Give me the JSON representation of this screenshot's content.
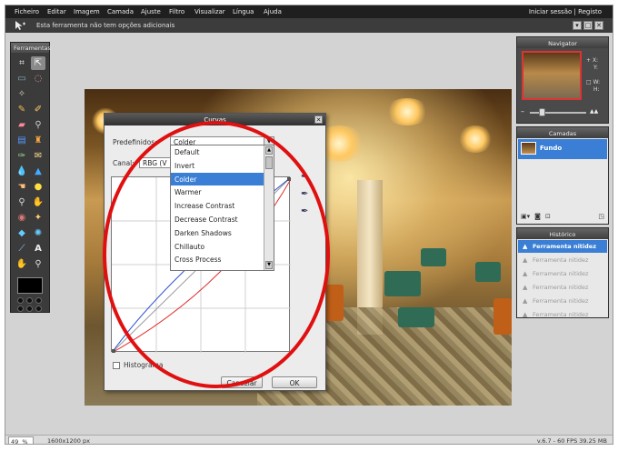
{
  "menubar": {
    "items": [
      "Ficheiro",
      "Editar",
      "Imagem",
      "Camada",
      "Ajuste",
      "Filtro",
      "Visualizar",
      "Língua",
      "Ajuda"
    ],
    "right_text": "Iniciar sessão  |  Registo"
  },
  "optionsbar": {
    "message": "Esta ferramenta não tem opções adicionais"
  },
  "tools_panel": {
    "title": "Ferramentas"
  },
  "curves_dialog": {
    "title": "Curvas",
    "preset_label": "Predefinidos:",
    "preset_value": "Colder",
    "channel_label": "Canal:",
    "channel_value": "RBG (V",
    "histogram_label": "Histograma",
    "cancel_label": "Cancelar",
    "ok_label": "OK"
  },
  "preset_dropdown": {
    "options": [
      "Default",
      "Invert",
      "Colder",
      "Warmer",
      "Increase Contrast",
      "Decrease Contrast",
      "Darken Shadows",
      "Chillauto",
      "Cross Process"
    ],
    "selected": "Colder"
  },
  "navigator": {
    "title": "Navigator",
    "x_label": "X:",
    "y_label": "Y:",
    "w_label": "W:",
    "h_label": "H:"
  },
  "layers": {
    "title": "Camadas",
    "items": [
      {
        "name": "Fundo"
      }
    ]
  },
  "history": {
    "title": "Histórico",
    "items": [
      "Ferramenta nitidez",
      "Ferramenta nitidez",
      "Ferramenta nitidez",
      "Ferramenta nitidez",
      "Ferramenta nitidez",
      "Ferramenta nitidez"
    ],
    "active_index": 0
  },
  "status": {
    "zoom": "49",
    "zoom_unit": "%",
    "dimensions": "1600x1200 px",
    "fps": "v.6.7 - 60 FPS 39.25 MB"
  },
  "colors": {
    "selection_blue": "#3a7fd5",
    "annotation_red": "#e01010",
    "curve_blue": "#2a4fd0",
    "curve_red": "#e03030"
  },
  "icons": {
    "tools": [
      "crop-icon",
      "move-icon",
      "marquee-icon",
      "lasso-icon",
      "wand-icon",
      "pencil-icon",
      "brush-icon",
      "eraser-icon",
      "stamp-icon",
      "gradient-icon",
      "bucket-icon",
      "replace-color-icon",
      "drop-icon",
      "sharpen-icon",
      "smudge-icon",
      "sponge-icon",
      "dodge-icon",
      "burn-icon",
      "red-eye-icon",
      "bloat-icon",
      "pinch-icon",
      "spot-heal-icon",
      "picker-icon",
      "text-icon",
      "hand-icon",
      "zoom-icon"
    ]
  }
}
